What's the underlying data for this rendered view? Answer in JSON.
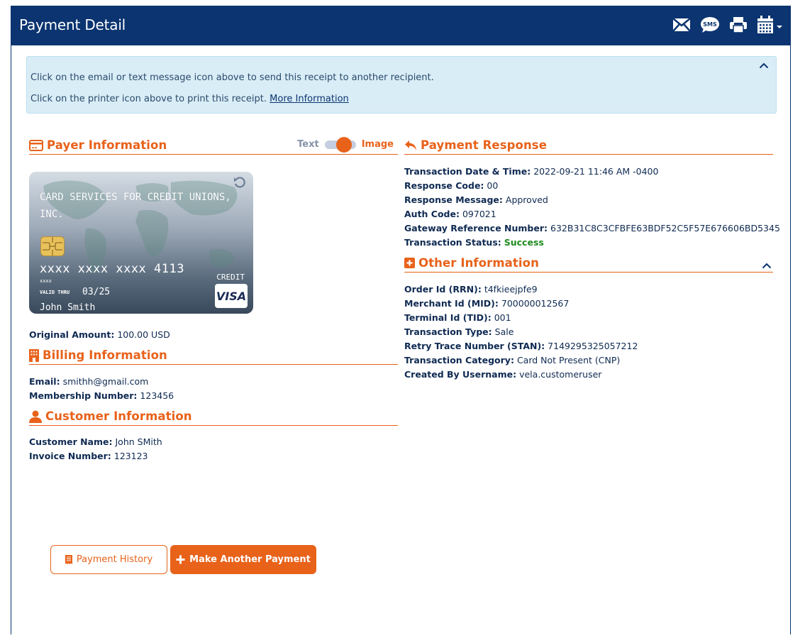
{
  "header": {
    "title": "Payment Detail",
    "actions": [
      {
        "name": "email-icon",
        "label": "Email"
      },
      {
        "name": "sms-icon",
        "label": "SMS"
      },
      {
        "name": "print-icon",
        "label": "Print"
      },
      {
        "name": "calendar-icon",
        "label": "Calendar"
      }
    ]
  },
  "alert": {
    "line1": "Click on the email or text message icon above to send this receipt to another recipient.",
    "line2_prefix": "Click on the printer icon above to print this receipt. ",
    "link": "More Information"
  },
  "payer": {
    "title": "Payer Information",
    "toggle": {
      "text_label": "Text",
      "image_label": "Image",
      "selected": "Image"
    },
    "card": {
      "issuer": "CARD SERVICES FOR CREDIT UNIONS, INC.",
      "number": "xxxx xxxx xxxx 4113",
      "small_number": "xxxx",
      "valid_thru_label": "VALID THRU",
      "valid_thru": "03/25",
      "holder": "John Smith",
      "type": "CREDIT",
      "brand": "VISA"
    },
    "original_amount": {
      "label": "Original Amount:",
      "value": "100.00 USD"
    }
  },
  "billing": {
    "title": "Billing Information",
    "fields": [
      {
        "label": "Email:",
        "value": "smithh@gmail.com"
      },
      {
        "label": "Membership Number:",
        "value": "123456"
      }
    ]
  },
  "customer": {
    "title": "Customer Information",
    "fields": [
      {
        "label": "Customer Name:",
        "value": "John SMith"
      },
      {
        "label": "Invoice Number:",
        "value": "123123"
      }
    ]
  },
  "response": {
    "title": "Payment Response",
    "fields": [
      {
        "label": "Transaction Date & Time:",
        "value": "2022-09-21 11:46 AM -0400"
      },
      {
        "label": "Response Code:",
        "value": "00"
      },
      {
        "label": "Response Message:",
        "value": "Approved"
      },
      {
        "label": "Auth Code:",
        "value": "097021"
      },
      {
        "label": "Gateway Reference Number:",
        "value": "632B31C8C3CFBFE63BDF52C5F57E676606BD5345"
      },
      {
        "label": "Transaction Status:",
        "value": "Success"
      }
    ]
  },
  "other": {
    "title": "Other Information",
    "fields": [
      {
        "label": "Order Id (RRN):",
        "value": "t4fkieejpfe9"
      },
      {
        "label": "Merchant Id (MID):",
        "value": "700000012567"
      },
      {
        "label": "Terminal Id (TID):",
        "value": "001"
      },
      {
        "label": "Transaction Type:",
        "value": "Sale"
      },
      {
        "label": "Retry Trace Number (STAN):",
        "value": "7149295325057212"
      },
      {
        "label": "Transaction Category:",
        "value": "Card Not Present (CNP)"
      },
      {
        "label": "Created By Username:",
        "value": "vela.customeruser"
      }
    ]
  },
  "buttons": {
    "history": "Payment History",
    "another": "Make Another Payment"
  },
  "colors": {
    "brand": "#0b3470",
    "accent": "#e8621a",
    "success": "#1e8a1e",
    "alert_bg": "#d9edf7"
  }
}
